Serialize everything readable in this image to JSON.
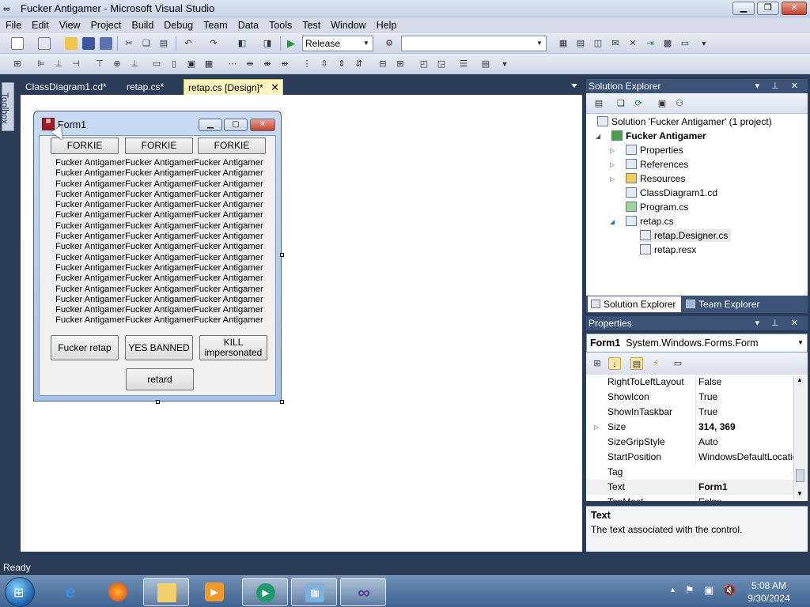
{
  "window": {
    "title": "Fucker Antigamer - Microsoft Visual Studio",
    "icon": "infinity-icon"
  },
  "menu": [
    "File",
    "Edit",
    "View",
    "Project",
    "Build",
    "Debug",
    "Team",
    "Data",
    "Tools",
    "Test",
    "Window",
    "Help"
  ],
  "toolbar": {
    "config_value": "Release",
    "platform_value": ""
  },
  "toolbox": {
    "label": "Toolbox"
  },
  "tabs": [
    {
      "label": "ClassDiagram1.cd*"
    },
    {
      "label": "retap.cs*"
    },
    {
      "label": "retap.cs [Design]*"
    }
  ],
  "form": {
    "title": "Form1",
    "top_buttons": [
      "FORKIE",
      "FORKIE",
      "FORKIE"
    ],
    "label_text": "Fucker Antigamer",
    "bottom_buttons": [
      "Fucker retap",
      "YES BANNED",
      "KILL",
      "impersonated"
    ],
    "retard_button": "retard"
  },
  "solution_explorer": {
    "title": "Solution Explorer",
    "solution": "Solution 'Fucker Antigamer' (1 project)",
    "project": "Fucker Antigamer",
    "items": [
      "Properties",
      "References",
      "Resources",
      "ClassDiagram1.cd",
      "Program.cs",
      "retap.cs",
      "retap.Designer.cs",
      "retap.resx"
    ],
    "tab_solution": "Solution Explorer",
    "tab_team": "Team Explorer"
  },
  "properties": {
    "title": "Properties",
    "object_name": "Form1",
    "object_type": "System.Windows.Forms.Form",
    "rows": [
      {
        "name": "RightToLeftLayout",
        "value": "False"
      },
      {
        "name": "ShowIcon",
        "value": "True"
      },
      {
        "name": "ShowInTaskbar",
        "value": "True"
      },
      {
        "name": "Size",
        "value": "314, 369"
      },
      {
        "name": "SizeGripStyle",
        "value": "Auto"
      },
      {
        "name": "StartPosition",
        "value": "WindowsDefaultLocation"
      },
      {
        "name": "Tag",
        "value": ""
      },
      {
        "name": "Text",
        "value": "Form1"
      },
      {
        "name": "TopMost",
        "value": "False"
      }
    ],
    "desc_title": "Text",
    "desc_text": "The text associated with the control."
  },
  "status": {
    "text": "Ready"
  },
  "taskbar": {
    "time": "5:08 AM",
    "date": "9/30/2024"
  },
  "colors": {
    "accent": "#3d5277",
    "tab_active": "#fdf4bf",
    "chrome": "#2b3c59"
  }
}
